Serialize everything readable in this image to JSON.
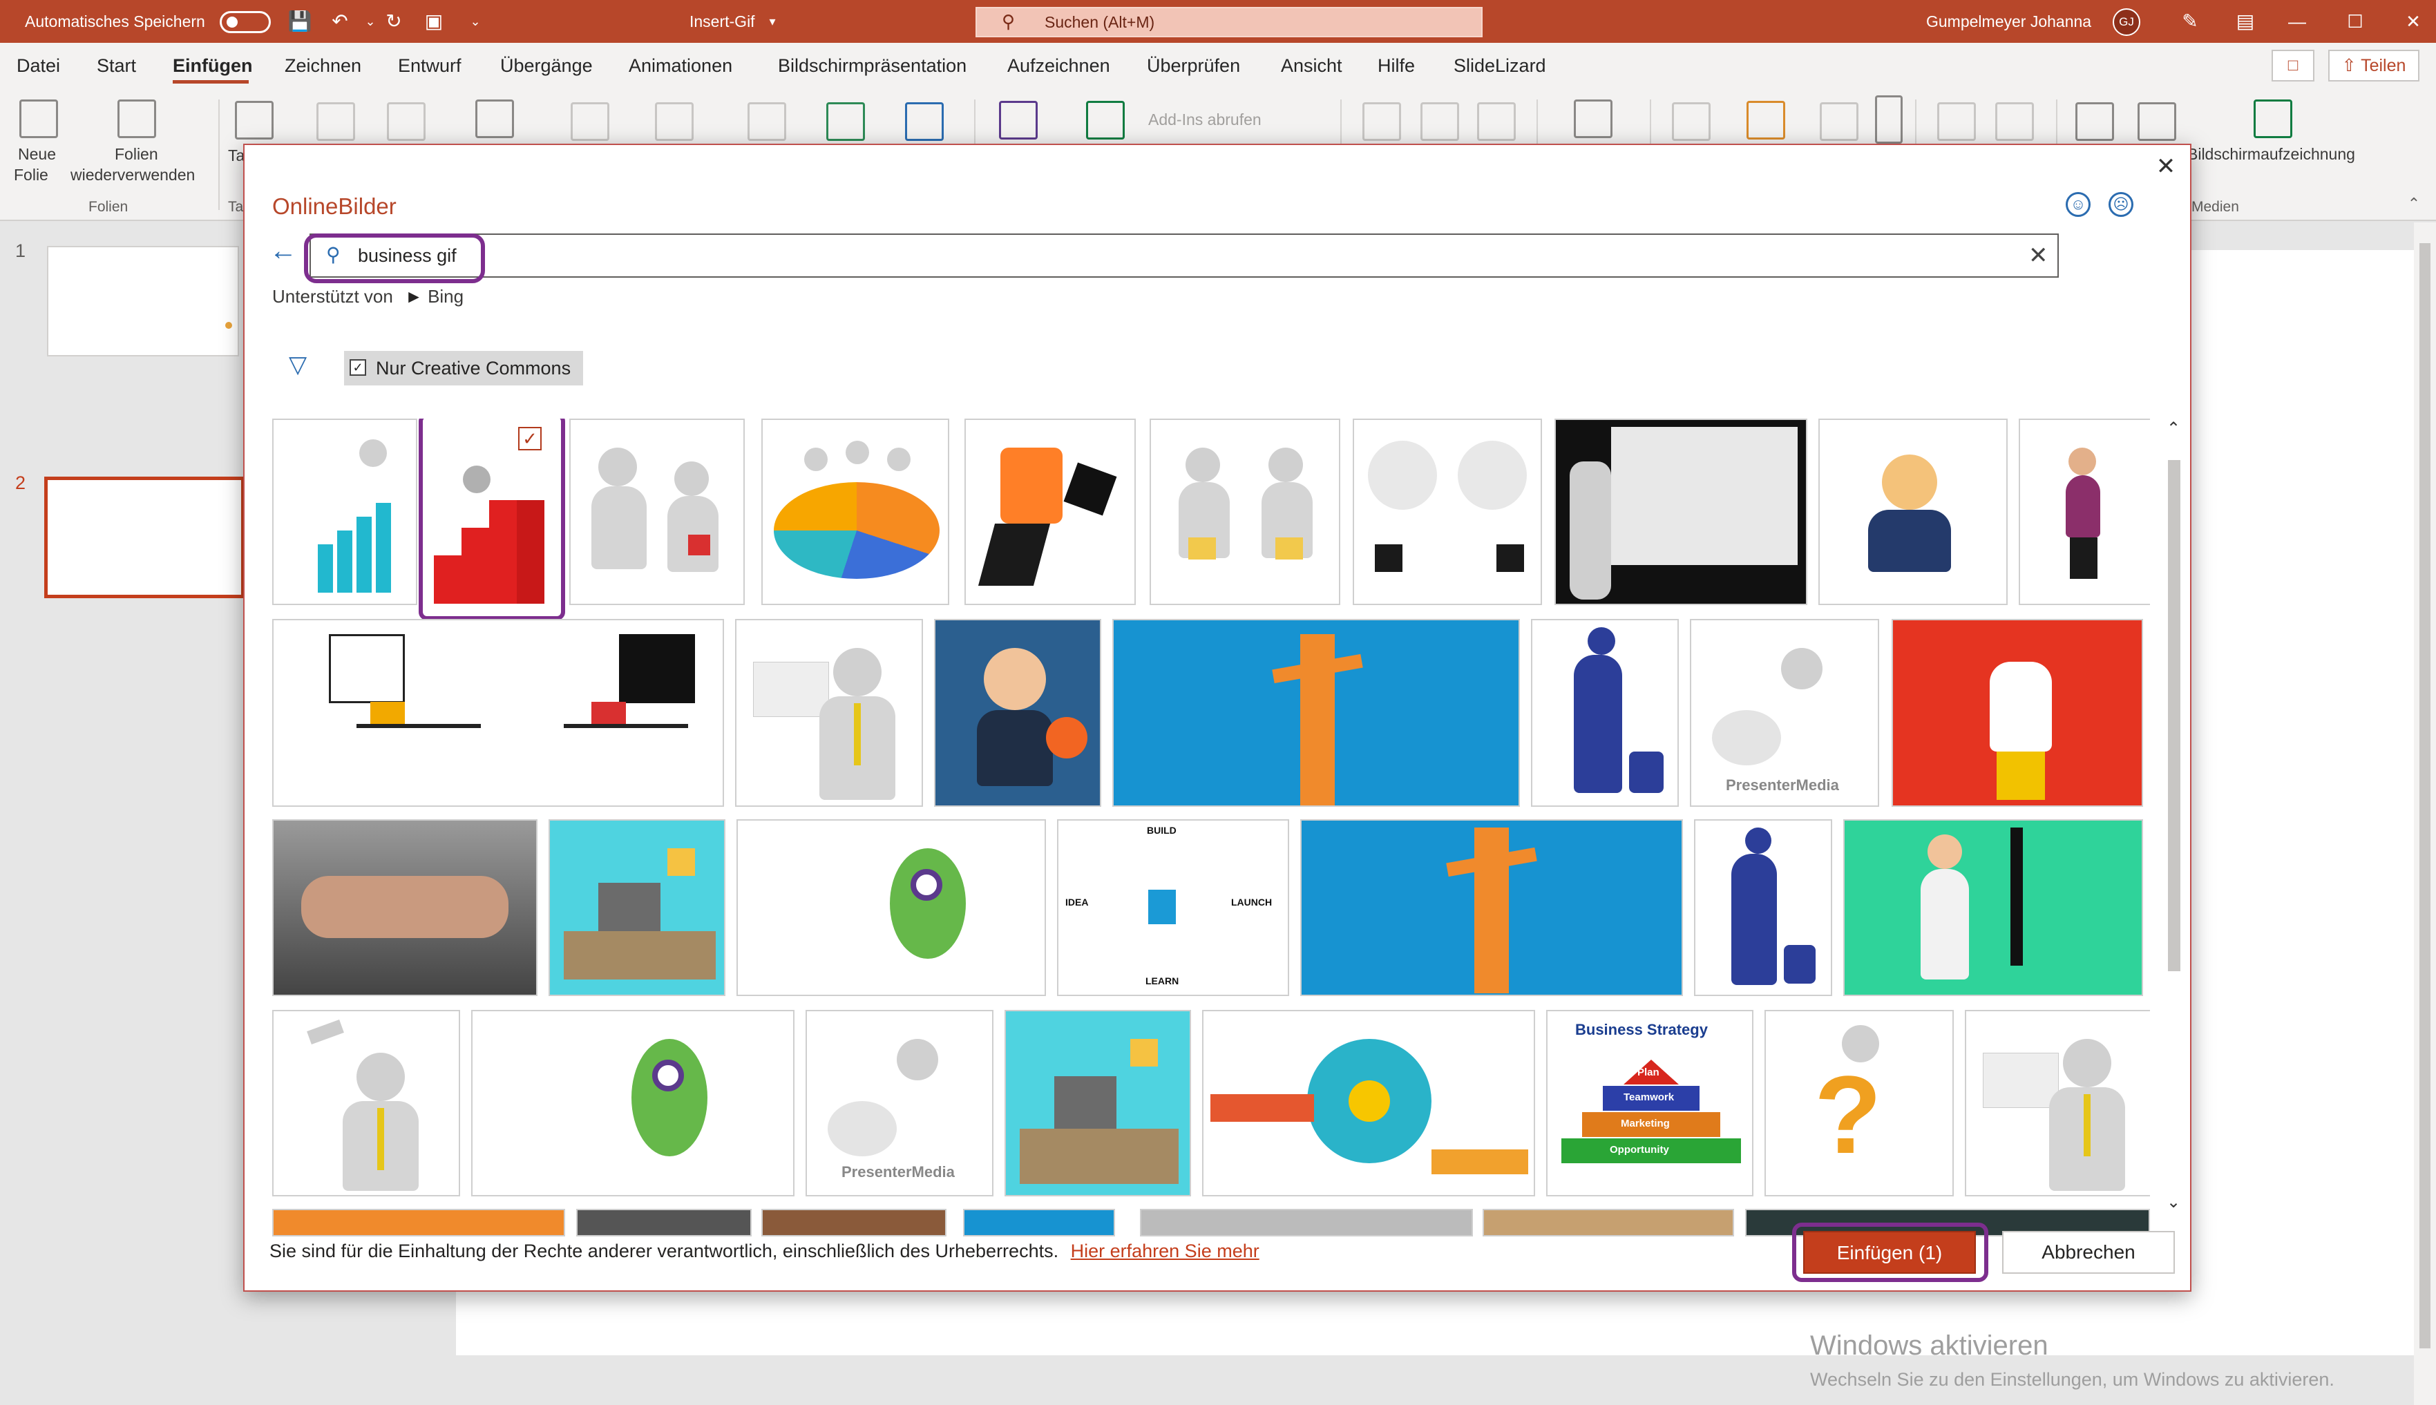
{
  "titlebar": {
    "autosave_label": "Automatisches Speichern",
    "doc_title": "Insert-Gif",
    "search_placeholder": "Suchen (Alt+M)",
    "user_name": "Gumpelmeyer Johanna",
    "user_initials": "GJ",
    "accent_color": "#b7472a"
  },
  "menu": {
    "tabs": [
      "Datei",
      "Start",
      "Einfügen",
      "Zeichnen",
      "Entwurf",
      "Übergänge",
      "Animationen",
      "Bildschirmpräsentation",
      "Aufzeichnen",
      "Überprüfen",
      "Ansicht",
      "Hilfe",
      "SlideLizard"
    ],
    "active_tab": "Einfügen",
    "share_label": "Teilen"
  },
  "ribbon": {
    "new_slide_line1": "Neue",
    "new_slide_line2": "Folie",
    "reuse_line1": "Folien",
    "reuse_line2": "wiederverwenden",
    "group_slides": "Folien",
    "addins_label": "Add-Ins abrufen",
    "screen_recording": "Bildschirmaufzeichnung",
    "group_media": "Medien",
    "group_ta": "Ta"
  },
  "slides": {
    "numbers": [
      "1",
      "2"
    ],
    "selected": 2
  },
  "dialog": {
    "title": "OnlineBilder",
    "search_value": "business gif",
    "powered_by": "Unterstützt von",
    "bing": "Bing",
    "filter_label": "Nur Creative Commons",
    "filter_checked": true,
    "footer_text": "Sie sind für die Einhaltung der Rechte anderer verantwortlich, einschließlich des Urheberrechts.",
    "footer_link": "Hier erfahren Sie mehr",
    "insert_button": "Einfügen (1)",
    "cancel_button": "Abbrechen",
    "selected_count": 1
  },
  "tiles": {
    "presenter_media_1": "PresenterMedia",
    "presenter_media_2": "PresenterMedia",
    "lean_idea": "IDEA",
    "lean_build": "BUILD",
    "lean_launch": "LAUNCH",
    "lean_learn": "LEARN",
    "strategy_title": "Business Strategy",
    "strategy_plan": "Plan",
    "strategy_teamwork": "Teamwork",
    "strategy_marketing": "Marketing",
    "strategy_opportunity": "Opportunity"
  },
  "watermark": {
    "title": "Windows aktivieren",
    "subtitle": "Wechseln Sie zu den Einstellungen, um Windows zu aktivieren."
  }
}
